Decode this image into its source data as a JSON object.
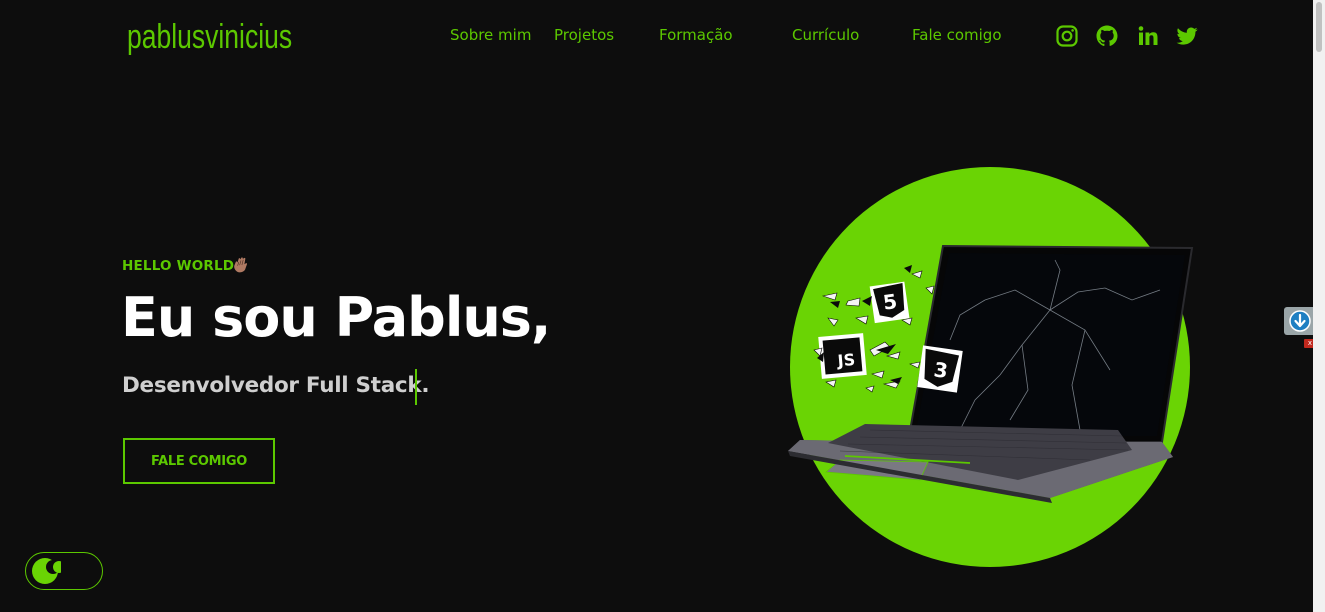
{
  "header": {
    "logo": "pablusvinicius",
    "nav": [
      {
        "label": "Sobre mim"
      },
      {
        "label": "Projetos"
      },
      {
        "label": "Formação"
      },
      {
        "label": "Currículo"
      },
      {
        "label": "Fale comigo"
      }
    ],
    "social": [
      "instagram-icon",
      "github-icon",
      "linkedin-icon",
      "twitter-icon"
    ]
  },
  "hero": {
    "greeting": "HELLO WORLD",
    "greeting_emoji": "waving-hand-icon",
    "headline": "Eu sou Pablus,",
    "subtitle": "Desenvolvedor Full Stack.",
    "cta_label": "FALE COMIGO"
  },
  "illustration": {
    "badges": [
      "JS",
      "5",
      "3"
    ]
  },
  "widget": {
    "close_label": "x"
  },
  "colors": {
    "accent": "#5cc800",
    "circle": "#6ad404",
    "background": "#0d0d0d",
    "text": "#ffffff",
    "subtitle": "#cfcfcf"
  }
}
